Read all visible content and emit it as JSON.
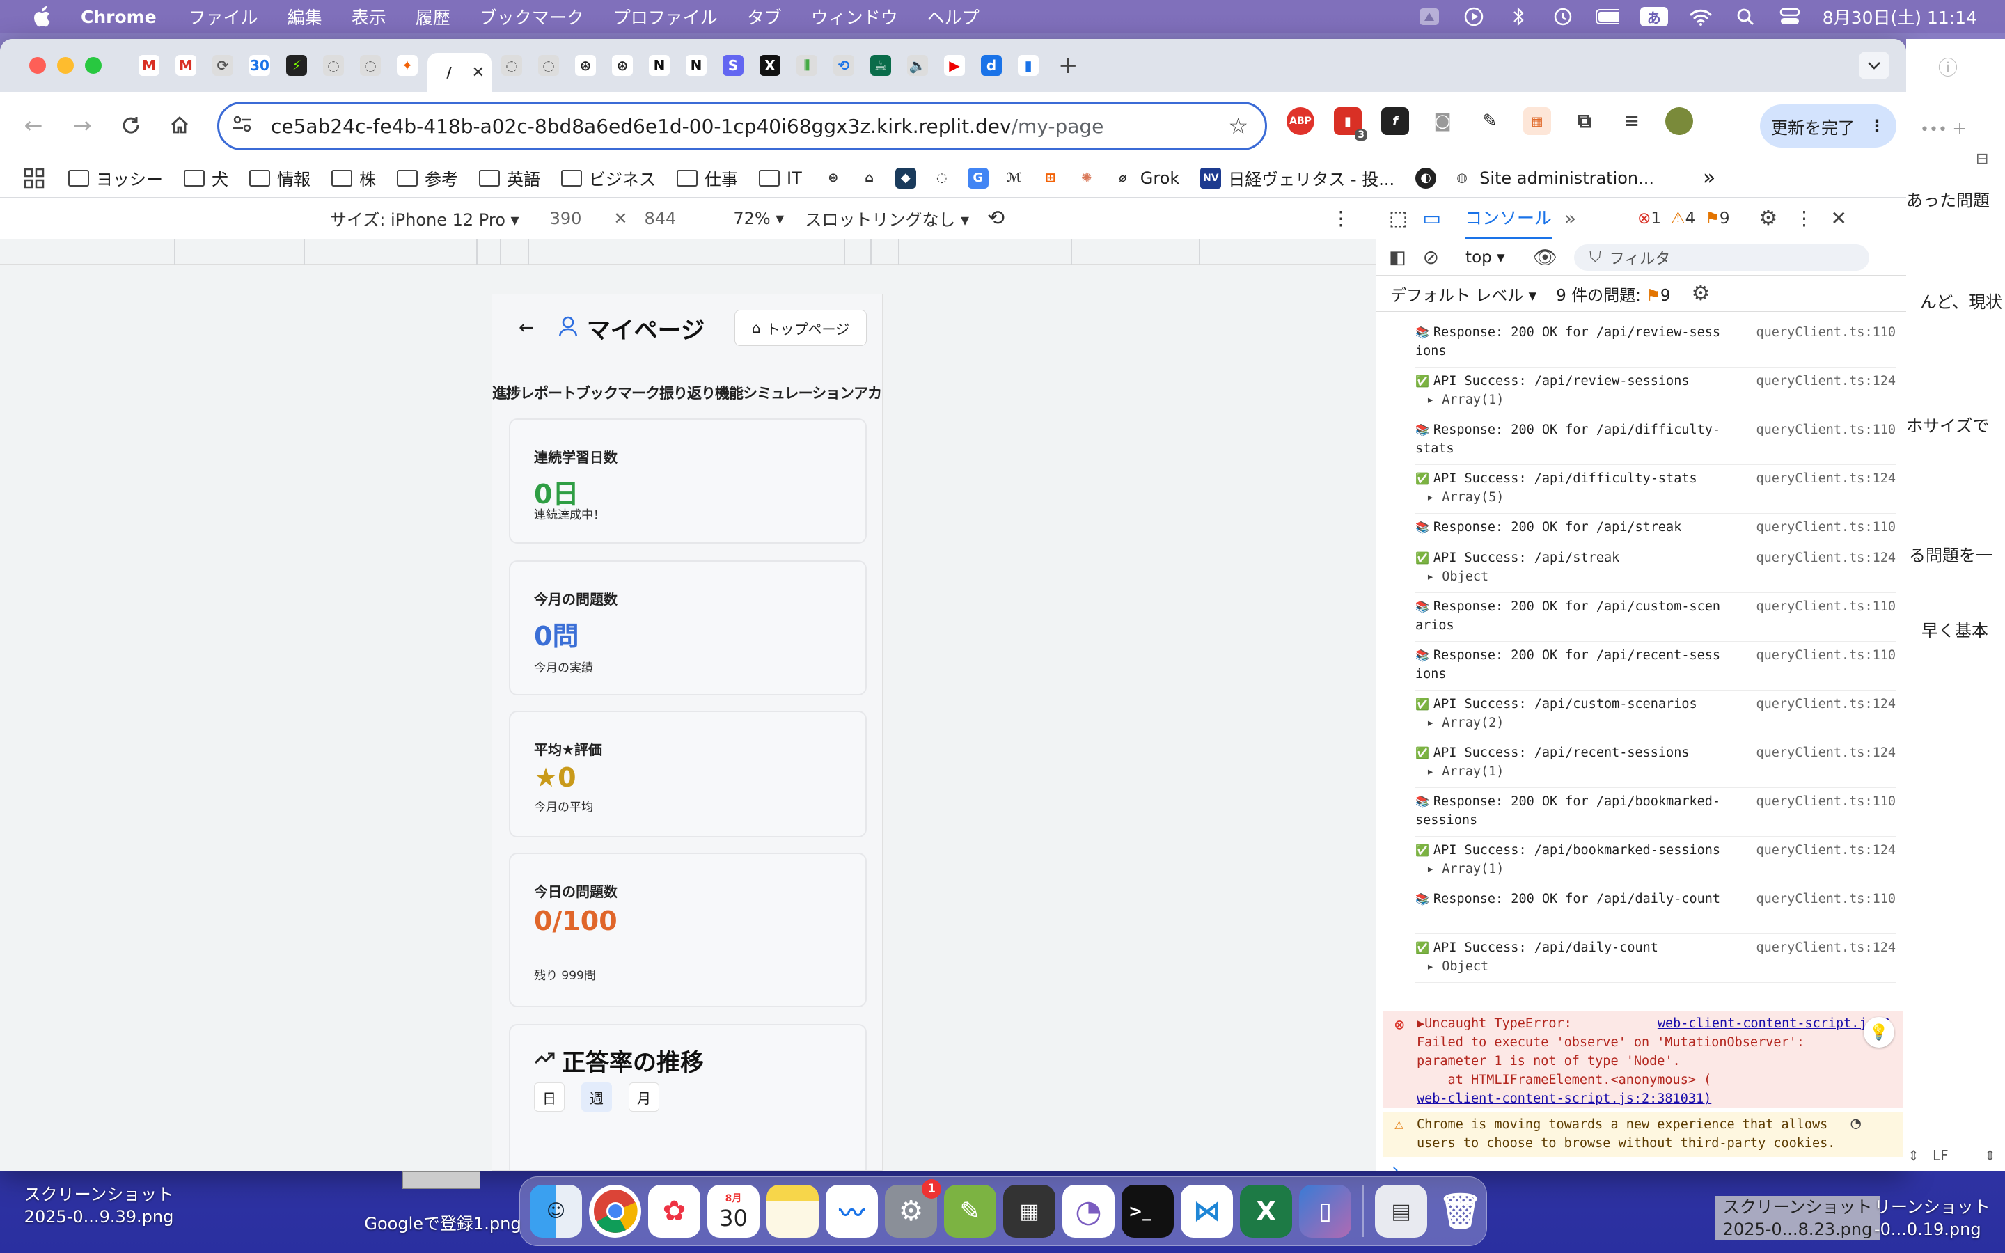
{
  "menubar": {
    "app": "Chrome",
    "items": [
      "ファイル",
      "編集",
      "表示",
      "履歴",
      "ブックマーク",
      "プロファイル",
      "タブ",
      "ウィンドウ",
      "ヘルプ"
    ],
    "input_method": "あ",
    "clock": "8月30日(土) 11:14"
  },
  "tabs": {
    "favicons": [
      "M",
      "M",
      "⟳",
      "30",
      "⚡",
      "◌",
      "◌",
      "✦",
      "/",
      "◌",
      "◌",
      "⊛",
      "⊛",
      "N",
      "N",
      "S",
      "X",
      "⦀",
      "⟲",
      "☕",
      "🔈",
      "▶",
      "d",
      "▮"
    ],
    "active_index": 8,
    "close": "✕",
    "new_tab": "+"
  },
  "toolbar": {
    "url_domain": "ce5ab24c-fe4b-418b-a02c-8bd8a6ed6e1d-00-1cp40i68ggx3z.kirk.replit.dev",
    "url_path": "/my-page",
    "update_label": "更新を完了",
    "ext_badge": "3",
    "ext_abp": "ABP"
  },
  "bookmarks": [
    {
      "label": "ヨッシー",
      "type": "folder"
    },
    {
      "label": "犬",
      "type": "folder"
    },
    {
      "label": "情報",
      "type": "folder"
    },
    {
      "label": "株",
      "type": "folder"
    },
    {
      "label": "参考",
      "type": "folder"
    },
    {
      "label": "英語",
      "type": "folder"
    },
    {
      "label": "ビジネス",
      "type": "folder"
    },
    {
      "label": "仕事",
      "type": "folder"
    },
    {
      "label": "IT",
      "type": "folder"
    },
    {
      "label": "Grok",
      "type": "site"
    },
    {
      "label": "日経ヴェリタス - 投...",
      "type": "site"
    },
    {
      "label": "Site administration...",
      "type": "site"
    }
  ],
  "devbar": {
    "device": "サイズ: iPhone 12 Pro",
    "width": "390",
    "height": "844",
    "zoom": "72%",
    "throttle": "スロットリングなし"
  },
  "phone": {
    "title": "マイページ",
    "top_button": "トップページ",
    "tabs_text": "進捗レポートブックマーク振り返り機能シミュレーションアカウント",
    "cards": [
      {
        "label": "連続学習日数",
        "value": "0日",
        "sub": "連続達成中！",
        "color": "#2f9e44"
      },
      {
        "label": "今月の問題数",
        "value": "0問",
        "sub": "今月の実績",
        "color": "#3b6fd6"
      },
      {
        "label": "平均★評価",
        "value": "★0",
        "sub": "今月の平均",
        "color": "#c99a1a"
      },
      {
        "label": "今日の問題数",
        "value": "0/100",
        "sub": "残り 999問",
        "color": "#e0662a"
      }
    ],
    "trend_title": "正答率の推移",
    "segments": [
      "日",
      "週",
      "月"
    ]
  },
  "devtools": {
    "tab_console": "コンソール",
    "errors": "1",
    "warnings": "4",
    "issues": "9",
    "context": "top",
    "filter_placeholder": "フィルタ",
    "level": "デフォルト レベル",
    "issues_label": "9 件の問題:",
    "issues_count": "9",
    "logs": [
      {
        "icon": "📚",
        "text": "Response: 200 OK for /api/review-sessions",
        "src": "queryClient.ts:110",
        "extra": ""
      },
      {
        "icon": "✅",
        "text": "API Success: /api/review-sessions",
        "src": "queryClient.ts:124",
        "extra": "Array(1)"
      },
      {
        "icon": "📚",
        "text": "Response: 200 OK for /api/difficulty-stats",
        "src": "queryClient.ts:110",
        "extra": ""
      },
      {
        "icon": "✅",
        "text": "API Success: /api/difficulty-stats",
        "src": "queryClient.ts:124",
        "extra": "Array(5)"
      },
      {
        "icon": "📚",
        "text": "Response: 200 OK for /api/streak",
        "src": "queryClient.ts:110",
        "extra": ""
      },
      {
        "icon": "✅",
        "text": "API Success: /api/streak",
        "src": "queryClient.ts:124",
        "extra": "Object"
      },
      {
        "icon": "📚",
        "text": "Response: 200 OK for /api/custom-scenarios",
        "src": "queryClient.ts:110",
        "extra": ""
      },
      {
        "icon": "📚",
        "text": "Response: 200 OK for /api/recent-sessions",
        "src": "queryClient.ts:110",
        "extra": ""
      },
      {
        "icon": "✅",
        "text": "API Success: /api/custom-scenarios",
        "src": "queryClient.ts:124",
        "extra": "Array(2)"
      },
      {
        "icon": "✅",
        "text": "API Success: /api/recent-sessions",
        "src": "queryClient.ts:124",
        "extra": "Array(1)"
      },
      {
        "icon": "📚",
        "text": "Response: 200 OK for /api/bookmarked-sessions",
        "src": "queryClient.ts:110",
        "extra": ""
      },
      {
        "icon": "✅",
        "text": "API Success: /api/bookmarked-sessions",
        "src": "queryClient.ts:124",
        "extra": "Array(1)"
      },
      {
        "icon": "📚",
        "text": "Response: 200 OK for /api/daily-count",
        "src": "queryClient.ts:110",
        "extra": ""
      },
      {
        "icon": "✅",
        "text": "API Success: /api/daily-count",
        "src": "queryClient.ts:124",
        "extra": "Object"
      }
    ],
    "error": {
      "head": "▶Uncaught TypeError:",
      "src": "web-client-content-script.js:2",
      "line1": "Failed to execute 'observe' on 'MutationObserver':",
      "line2": "parameter 1 is not of type 'Node'.",
      "line3": "    at HTMLIFrameElement.<anonymous> (",
      "line4": "web-client-content-script.js:2:381031)"
    },
    "warning": {
      "line1": "Chrome is moving towards a new experience that allows",
      "line2": "users to choose to browse without third-party cookies."
    },
    "prompt": "›"
  },
  "sidewin": {
    "lines": [
      "あった問題",
      "んど、現状",
      "ホサイズで",
      "る問題を一",
      "早く基本"
    ],
    "status": "LF"
  },
  "desktop": {
    "file1_line1": "スクリーンショット",
    "file1_line2": "2025-0...9.39.png",
    "file2": "Googleで登録1.png",
    "file3_line1": "スクリーンショット",
    "file3_line2": "2025-0...8.23.png",
    "file4_line1": "リーンショット",
    "file4_line2": "-0...0.19.png"
  },
  "dock": {
    "calendar_month": "8月",
    "calendar_day": "30",
    "settings_badge": "1"
  }
}
